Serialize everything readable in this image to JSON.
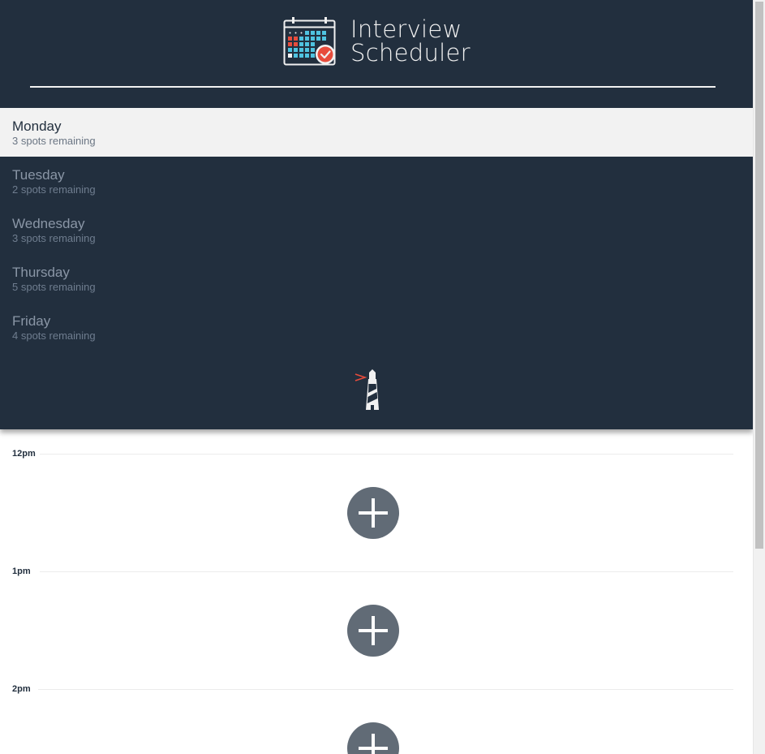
{
  "app": {
    "title_line1": "Interview",
    "title_line2": "Scheduler"
  },
  "days": [
    {
      "name": "Monday",
      "spots": "3 spots remaining",
      "selected": true
    },
    {
      "name": "Tuesday",
      "spots": "2 spots remaining",
      "selected": false
    },
    {
      "name": "Wednesday",
      "spots": "3 spots remaining",
      "selected": false
    },
    {
      "name": "Thursday",
      "spots": "5 spots remaining",
      "selected": false
    },
    {
      "name": "Friday",
      "spots": "4 spots remaining",
      "selected": false
    }
  ],
  "schedule": [
    {
      "time": "12pm"
    },
    {
      "time": "1pm"
    },
    {
      "time": "2pm"
    }
  ],
  "icons": {
    "logo": "calendar-check-icon",
    "footer": "lighthouse-icon",
    "add": "plus-icon"
  },
  "colors": {
    "sidebar_bg": "#222f3e",
    "selected_day_bg": "#f2f2f2",
    "add_button": "#616b76",
    "accent_red": "#e74c3c",
    "accent_cyan": "#4fc3e0"
  }
}
